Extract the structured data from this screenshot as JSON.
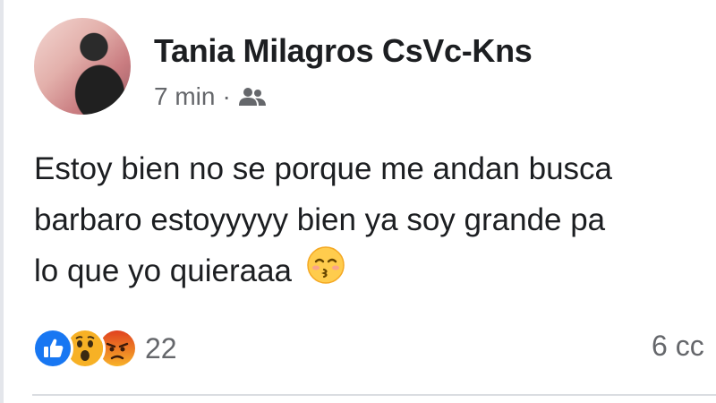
{
  "post": {
    "author": "Tania Milagros CsVc-Kns",
    "time": "7 min",
    "separator": "·",
    "audience_icon": "friends-icon",
    "text_lines": [
      "Estoy bien no se porque me andan busca",
      "barbaro estoyyyyy bien ya soy grande pa",
      "lo que yo quieraaa"
    ],
    "emoji": "kissing-face-emoji"
  },
  "footer": {
    "reactions": [
      "like",
      "wow",
      "angry"
    ],
    "reaction_count": "22",
    "comments_label": "6 cc"
  },
  "colors": {
    "like": "#1877f2",
    "wow": "#f7b125",
    "angry": "#e9710f",
    "meta_text": "#65676b"
  }
}
